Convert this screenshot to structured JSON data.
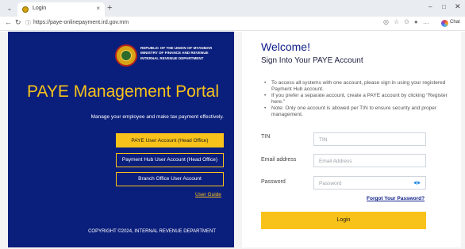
{
  "browser": {
    "tab_title": "Login",
    "tab_close": "×",
    "new_tab": "+",
    "url": "https://paye-onlinepayment.ird.gov.mm",
    "chat_label": "Chat",
    "window_controls": {
      "minimize": "–",
      "maximize": "□",
      "close": "✕"
    }
  },
  "left_panel": {
    "ministry_lines": [
      "REPUBLIC OF THE UNION OF MYANMAR",
      "MINISTRY OF FINANCE AND REVENUE",
      "INTERNAL REVENUE DEPARTMENT"
    ],
    "portal_title": "PAYE Management Portal",
    "tagline": "Manage your employee and make tax payment effectively.",
    "buttons": {
      "head_office": "PAYE User Account (Head Office)",
      "payment_hub": "Payment Hub User Account (Head Office)",
      "branch_office": "Branch Office User Account"
    },
    "user_guide": "User Guide",
    "copyright": "COPYRIGHT ©2024, INTERNAL REVENUE DEPARTMENT"
  },
  "right_panel": {
    "welcome": "Welcome!",
    "signin_title": "Sign Into Your PAYE Account",
    "notes": [
      "To access all systems with one account, please sign in using your registered Payment Hub account.",
      "If you prefer a separate account, create a PAYE account by clicking \"Register here.\"",
      "Note: Only one account is allowed per TIN to ensure security and proper management."
    ],
    "tin": {
      "label": "TIN",
      "value": "",
      "placeholder": "TIN"
    },
    "email": {
      "label": "Email address",
      "value": "",
      "placeholder": "Email Address"
    },
    "password": {
      "label": "Password",
      "value": "",
      "placeholder": "Password"
    },
    "forgot": "Forgot Your Password?",
    "login": "Login"
  },
  "colors": {
    "panel_navy": "#0a1e7c",
    "accent_yellow": "#f9c21a",
    "heading_blue": "#10208a"
  }
}
